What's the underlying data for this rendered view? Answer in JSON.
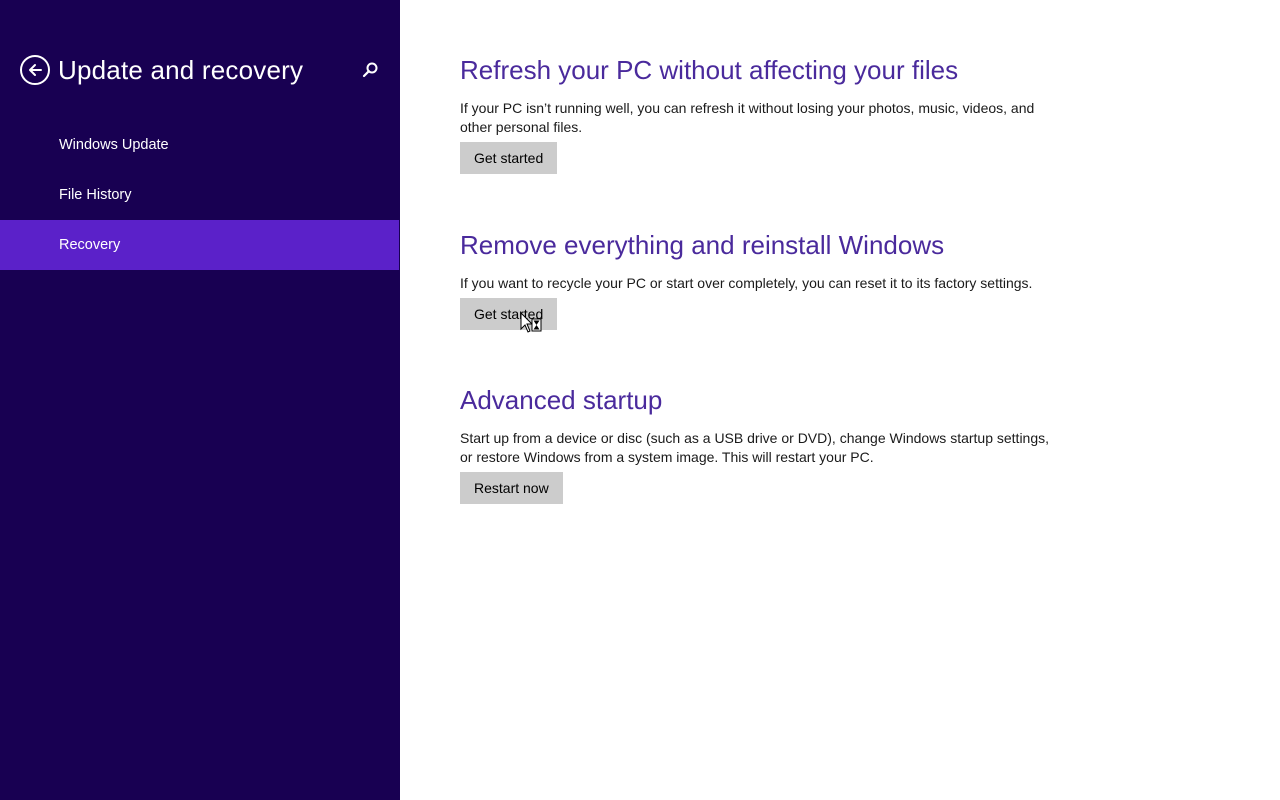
{
  "sidebar": {
    "title": "Update and recovery",
    "back_icon": "back-arrow-icon",
    "search_icon": "search-icon",
    "items": [
      {
        "label": "Windows Update",
        "selected": false
      },
      {
        "label": "File History",
        "selected": false
      },
      {
        "label": "Recovery",
        "selected": true
      }
    ]
  },
  "main": {
    "sections": [
      {
        "title": "Refresh your PC without affecting your files",
        "description": "If your PC isn’t running well, you can refresh it without losing your photos, music, videos, and other personal files.",
        "button": "Get started"
      },
      {
        "title": "Remove everything and reinstall Windows",
        "description": "If you want to recycle your PC or start over completely, you can reset it to its factory settings.",
        "button": "Get started"
      },
      {
        "title": "Advanced startup",
        "description": "Start up from a device or disc (such as a USB drive or DVD), change Windows startup settings, or restore Windows from a system image. This will restart your PC.",
        "button": "Restart now"
      }
    ]
  },
  "colors": {
    "sidebar_bg": "#180052",
    "selected_bg": "#5b21c9",
    "title_color": "#4a2a9c",
    "button_bg": "#cccccc"
  }
}
